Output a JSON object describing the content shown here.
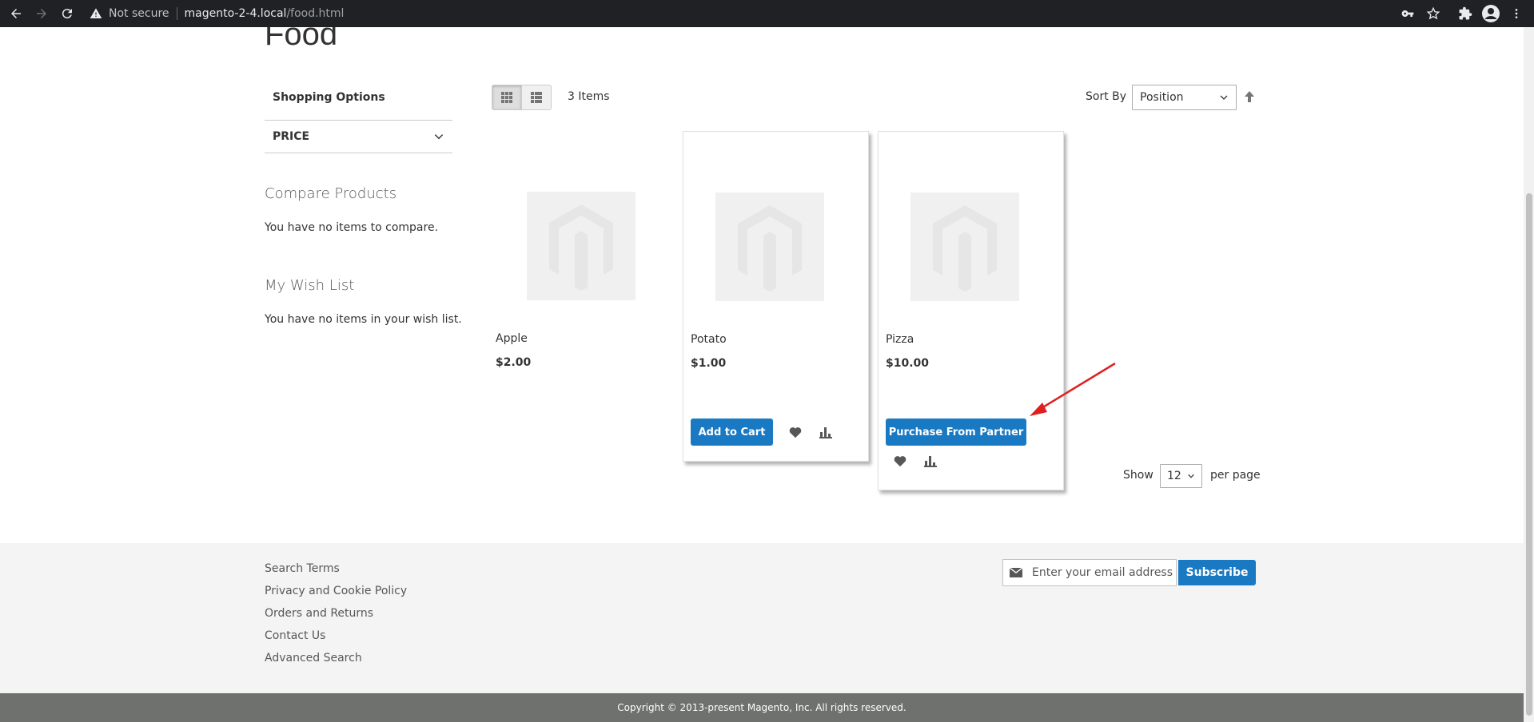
{
  "browser": {
    "security_label": "Not secure",
    "url_host": "magento-2-4.local",
    "url_path": "/food.html"
  },
  "page": {
    "title": "Food"
  },
  "sidebar": {
    "shopping_options": "Shopping Options",
    "filter_price": "PRICE",
    "compare_title": "Compare Products",
    "compare_empty": "You have no items to compare.",
    "wishlist_title": "My Wish List",
    "wishlist_empty": "You have no items in your wish list."
  },
  "toolbar": {
    "items_count": "3 Items",
    "sort_label": "Sort By",
    "sort_value": "Position",
    "show_label": "Show",
    "limit_value": "12",
    "per_page_label": "per page"
  },
  "products": [
    {
      "name": "Apple",
      "price": "$2.00"
    },
    {
      "name": "Potato",
      "price": "$1.00",
      "button": "Add to Cart"
    },
    {
      "name": "Pizza",
      "price": "$10.00",
      "button": "Purchase From Partner"
    }
  ],
  "footer": {
    "links": [
      "Search Terms",
      "Privacy and Cookie Policy",
      "Orders and Returns",
      "Contact Us",
      "Advanced Search"
    ],
    "newsletter_placeholder": "Enter your email address",
    "subscribe_label": "Subscribe",
    "copyright": "Copyright © 2013-present Magento, Inc. All rights reserved."
  },
  "colors": {
    "primary_button": "#1979c3",
    "annotation_arrow": "#e02020"
  }
}
